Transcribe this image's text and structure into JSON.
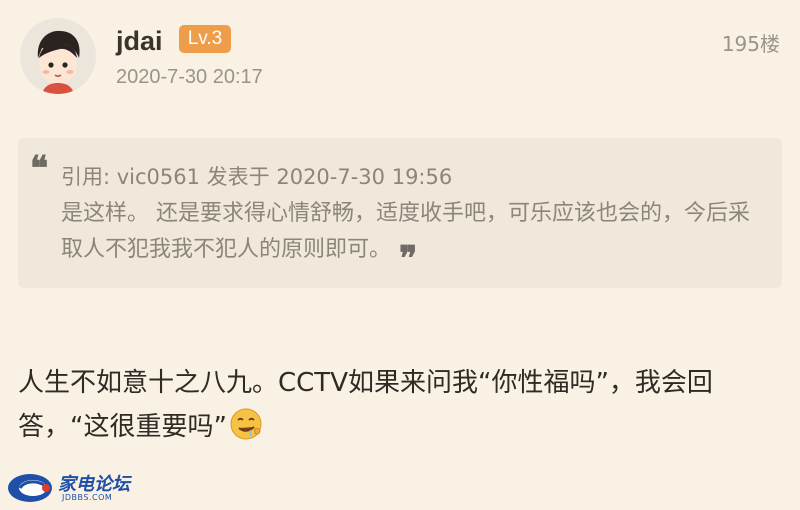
{
  "post": {
    "author": {
      "username": "jdai",
      "level": "Lv.3",
      "avatar_icon": "cartoon-avatar-icon"
    },
    "timestamp": "2020-7-30 20:17",
    "floor": "195楼",
    "quote": {
      "header": "引用: vic0561 发表于 2020-7-30 19:56",
      "body": "是这样。 还是要求得心情舒畅，适度收手吧，可乐应该也会的，今后采取人不犯我我不犯人的原则即可。",
      "open_mark": "❝",
      "close_mark": "❞"
    },
    "content": {
      "text": "人生不如意十之八九。CCTV如果来问我“你性福吗”，我会回答，“这很重要吗”",
      "emoji": "drooling-face-emoji"
    }
  },
  "watermark": {
    "title": "家电论坛",
    "subtitle": "JDBBS.COM"
  },
  "colors": {
    "background": "#f8f1e4",
    "quote_background": "#f0e8db",
    "badge": "#ee9d4a",
    "muted_text": "#9a9389",
    "watermark_blue": "#1f4fa6"
  }
}
